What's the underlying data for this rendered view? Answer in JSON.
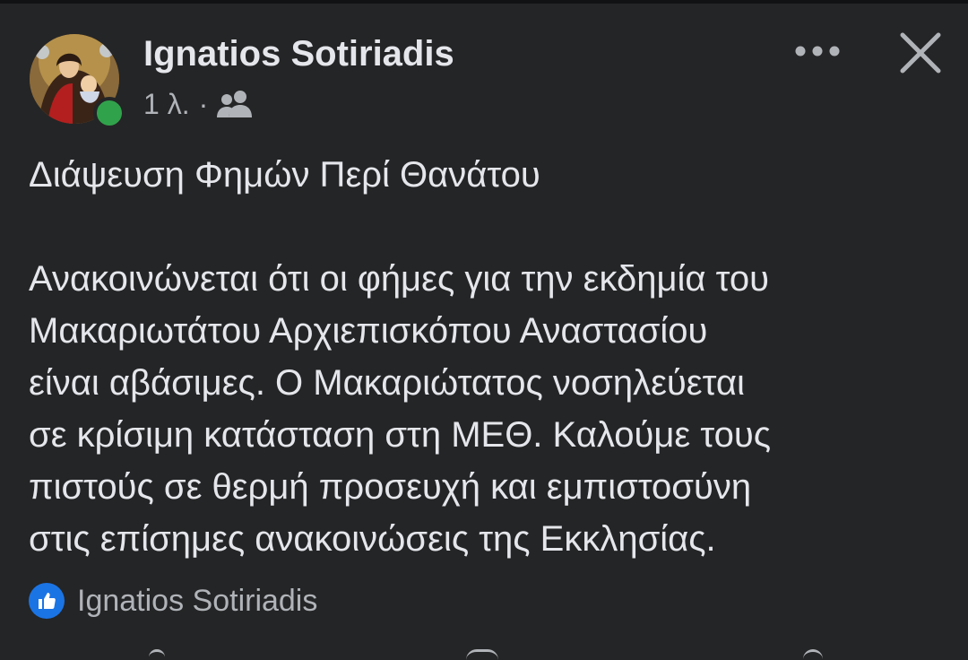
{
  "post": {
    "author": "Ignatios Sotiriadis",
    "timestamp": "1 λ.",
    "separator": "·",
    "audience_icon": "friends-icon",
    "title": "Διάψευση Φημών Περί Θανάτου",
    "body_lines": [
      "Ανακοινώνεται ότι οι φήμες για την εκδημία του",
      "Μακαριωτάτου Αρχιεπισκόπου Αναστασίου",
      "είναι αβάσιμες. Ο Μακαριώτατος νοσηλεύεται",
      "σε κρίσιμη κατάσταση στη ΜΕΘ. Καλούμε τους",
      "πιστούς σε θερμή προσευχή και εμπιστοσύνη",
      "στις επίσημες ανακοινώσεις της Εκκλησίας."
    ],
    "reactions": {
      "icon": "like-icon",
      "names": "Ignatios Sotiriadis"
    }
  },
  "header": {
    "more_icon": "more-options-icon",
    "close_icon": "close-icon"
  },
  "colors": {
    "background": "#242526",
    "text_primary": "#e4e6eb",
    "text_secondary": "#b0b3b8",
    "online": "#31a24c",
    "like": "#1b74e4"
  }
}
